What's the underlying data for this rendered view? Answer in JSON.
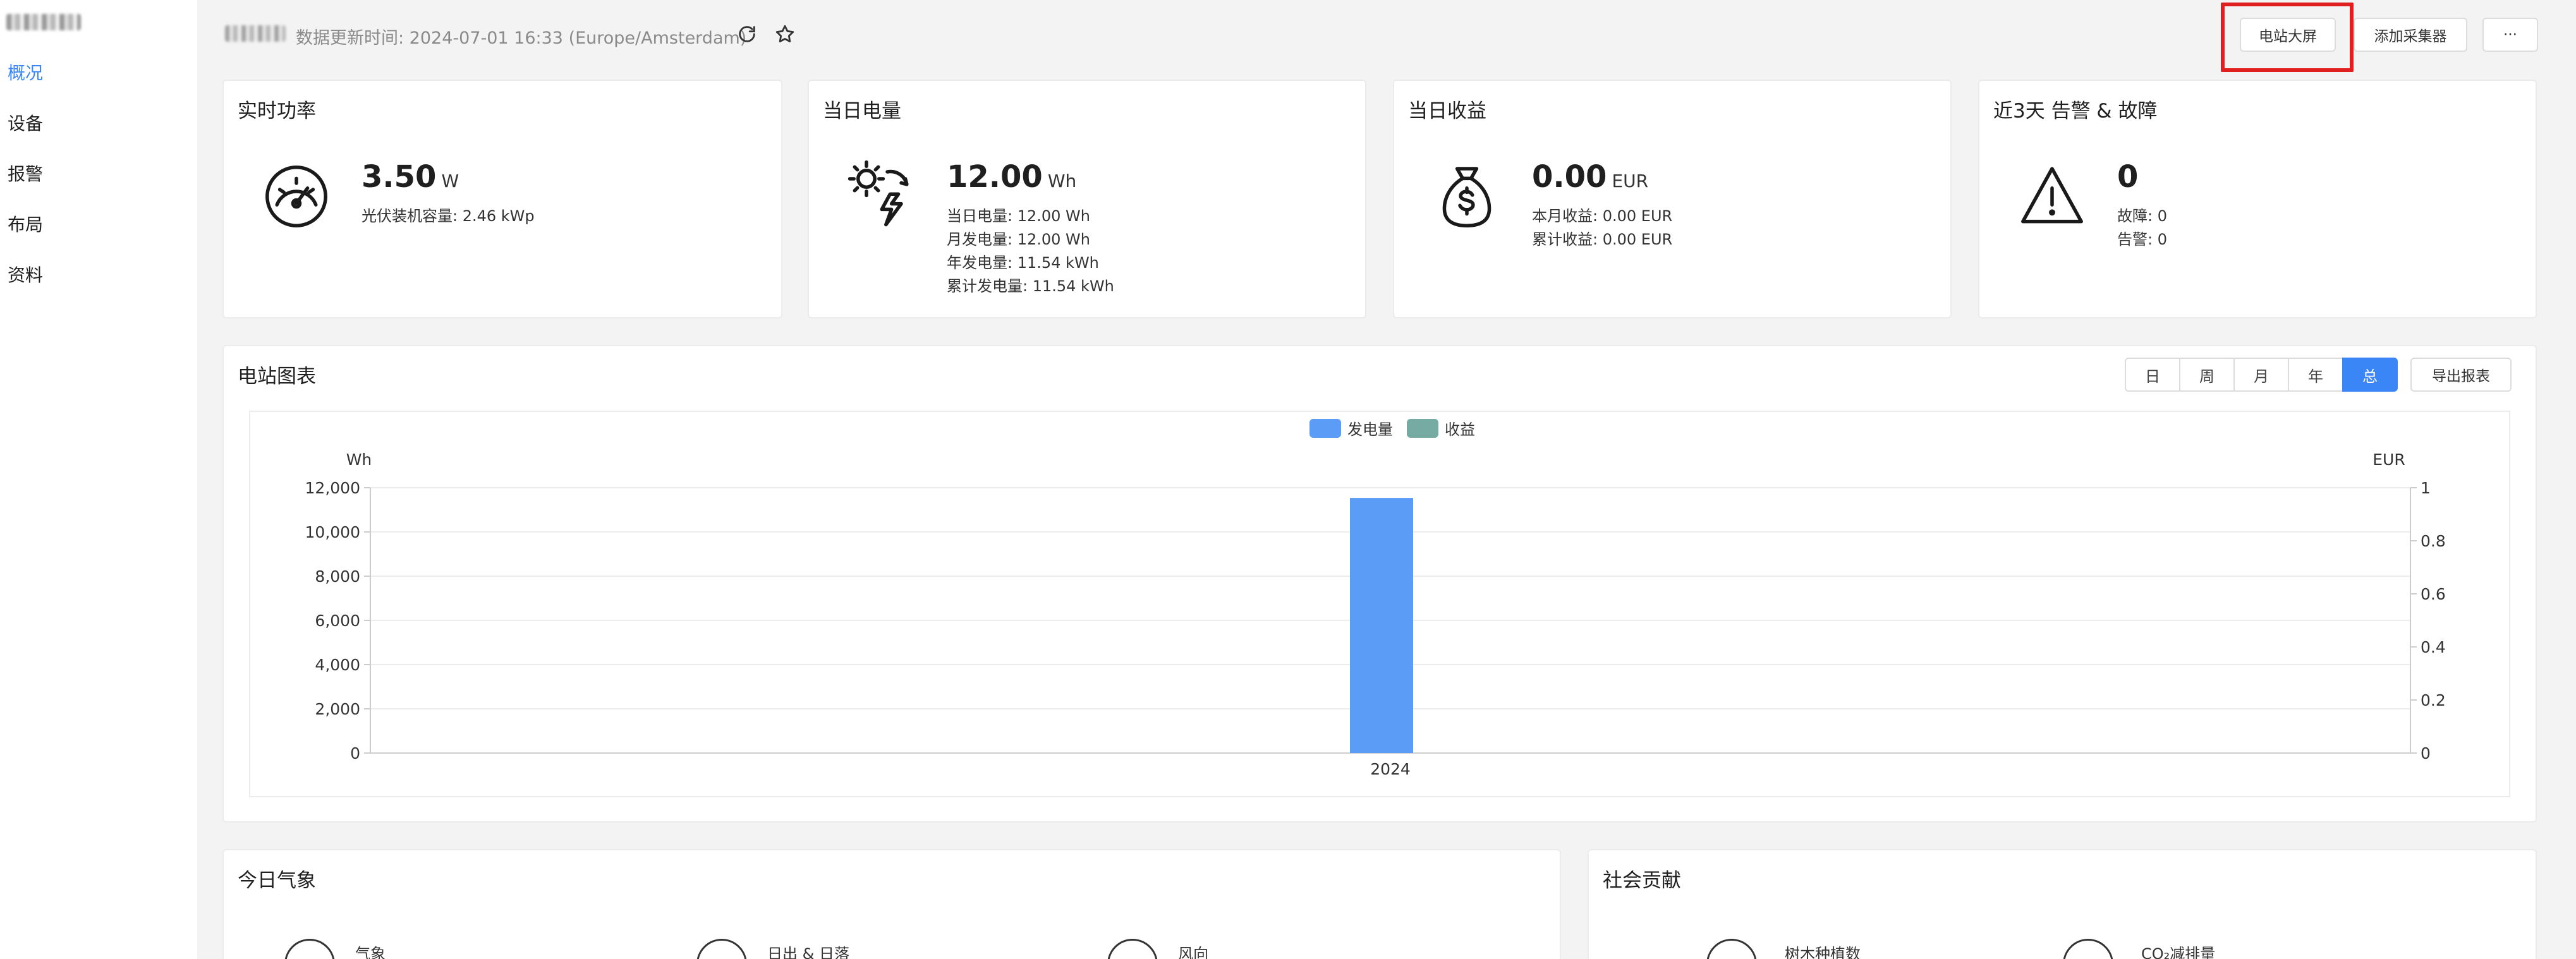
{
  "sidebar": {
    "items": [
      {
        "label": "概况",
        "active": true
      },
      {
        "label": "设备",
        "active": false
      },
      {
        "label": "报警",
        "active": false
      },
      {
        "label": "布局",
        "active": false
      },
      {
        "label": "资料",
        "active": false
      }
    ]
  },
  "header": {
    "update_text": "数据更新时间: 2024-07-01 16:33 (Europe/Amsterdam)",
    "refresh_icon": "refresh-icon",
    "star_icon": "star-icon",
    "buttons": {
      "big_screen": "电站大屏",
      "add_collector": "添加采集器",
      "more": "···"
    }
  },
  "stats": {
    "power": {
      "title": "实时功率",
      "value": "3.50",
      "unit": "W",
      "lines": [
        "光伏装机容量: 2.46 kWp"
      ]
    },
    "energy": {
      "title": "当日电量",
      "value": "12.00",
      "unit": "Wh",
      "lines": [
        "当日电量: 12.00 Wh",
        "月发电量: 12.00 Wh",
        "年发电量: 11.54 kWh",
        "累计发电量: 11.54 kWh"
      ]
    },
    "income": {
      "title": "当日收益",
      "value": "0.00",
      "unit": "EUR",
      "lines": [
        "本月收益: 0.00 EUR",
        "累计收益: 0.00 EUR"
      ]
    },
    "alarms": {
      "title": "近3天 告警 & 故障",
      "value": "0",
      "unit": "",
      "lines": [
        "故障: 0",
        "告警: 0"
      ]
    }
  },
  "chart_panel": {
    "title": "电站图表",
    "periods": [
      "日",
      "周",
      "月",
      "年",
      "总"
    ],
    "active_period": "总",
    "export": "导出报表"
  },
  "chart_data": {
    "type": "bar",
    "categories": [
      "2024"
    ],
    "series": [
      {
        "name": "发电量",
        "values": [
          11540
        ],
        "color": "#5b9cf6",
        "axis": "left"
      },
      {
        "name": "收益",
        "values": [
          0
        ],
        "color": "#76aba3",
        "axis": "right"
      }
    ],
    "ylabel_left": "Wh",
    "ylabel_right": "EUR",
    "ylim_left": [
      0,
      12000
    ],
    "ylim_right": [
      0,
      1
    ],
    "yticks_left": [
      "0",
      "2,000",
      "4,000",
      "6,000",
      "8,000",
      "10,000",
      "12,000"
    ],
    "yticks_right": [
      "0",
      "0.2",
      "0.4",
      "0.6",
      "0.8",
      "1"
    ],
    "grid": true,
    "legend_position": "top-center"
  },
  "weather": {
    "title": "今日气象",
    "items": [
      "气象",
      "日出 & 日落",
      "风向"
    ]
  },
  "social": {
    "title": "社会贡献",
    "items": [
      "树木种植数",
      "CO₂减排量"
    ]
  }
}
